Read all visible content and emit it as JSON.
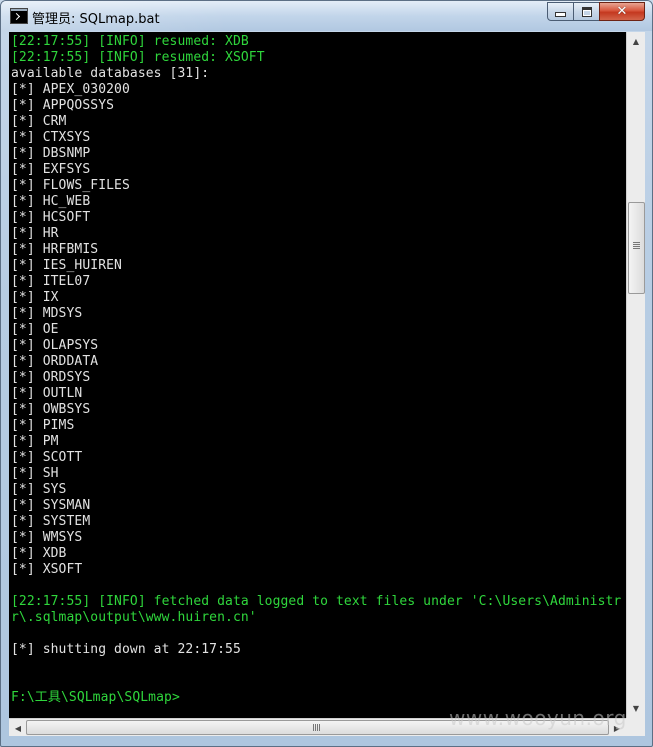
{
  "window": {
    "title": "管理员: SQLmap.bat",
    "icon": "console-window-icon"
  },
  "console": {
    "lines": [
      {
        "text": "[22:17:55] [INFO] resumed: XDB",
        "color": "#2fd63c"
      },
      {
        "text": "[22:17:55] [INFO] resumed: XSOFT",
        "color": "#2fd63c"
      },
      {
        "text": "available databases [31]:",
        "color": "#e2e2e2"
      },
      {
        "text": "[*] APEX_030200",
        "color": "#e2e2e2"
      },
      {
        "text": "[*] APPQOSSYS",
        "color": "#e2e2e2"
      },
      {
        "text": "[*] CRM",
        "color": "#e2e2e2"
      },
      {
        "text": "[*] CTXSYS",
        "color": "#e2e2e2"
      },
      {
        "text": "[*] DBSNMP",
        "color": "#e2e2e2"
      },
      {
        "text": "[*] EXFSYS",
        "color": "#e2e2e2"
      },
      {
        "text": "[*] FLOWS_FILES",
        "color": "#e2e2e2"
      },
      {
        "text": "[*] HC_WEB",
        "color": "#e2e2e2"
      },
      {
        "text": "[*] HCSOFT",
        "color": "#e2e2e2"
      },
      {
        "text": "[*] HR",
        "color": "#e2e2e2"
      },
      {
        "text": "[*] HRFBMIS",
        "color": "#e2e2e2"
      },
      {
        "text": "[*] IES_HUIREN",
        "color": "#e2e2e2"
      },
      {
        "text": "[*] ITEL07",
        "color": "#e2e2e2"
      },
      {
        "text": "[*] IX",
        "color": "#e2e2e2"
      },
      {
        "text": "[*] MDSYS",
        "color": "#e2e2e2"
      },
      {
        "text": "[*] OE",
        "color": "#e2e2e2"
      },
      {
        "text": "[*] OLAPSYS",
        "color": "#e2e2e2"
      },
      {
        "text": "[*] ORDDATA",
        "color": "#e2e2e2"
      },
      {
        "text": "[*] ORDSYS",
        "color": "#e2e2e2"
      },
      {
        "text": "[*] OUTLN",
        "color": "#e2e2e2"
      },
      {
        "text": "[*] OWBSYS",
        "color": "#e2e2e2"
      },
      {
        "text": "[*] PIMS",
        "color": "#e2e2e2"
      },
      {
        "text": "[*] PM",
        "color": "#e2e2e2"
      },
      {
        "text": "[*] SCOTT",
        "color": "#e2e2e2"
      },
      {
        "text": "[*] SH",
        "color": "#e2e2e2"
      },
      {
        "text": "[*] SYS",
        "color": "#e2e2e2"
      },
      {
        "text": "[*] SYSMAN",
        "color": "#e2e2e2"
      },
      {
        "text": "[*] SYSTEM",
        "color": "#e2e2e2"
      },
      {
        "text": "[*] WMSYS",
        "color": "#e2e2e2"
      },
      {
        "text": "[*] XDB",
        "color": "#e2e2e2"
      },
      {
        "text": "[*] XSOFT",
        "color": "#e2e2e2"
      },
      {
        "text": "",
        "color": "#e2e2e2"
      },
      {
        "text": "[22:17:55] [INFO] fetched data logged to text files under 'C:\\Users\\Administr",
        "color": "#2fd63c"
      },
      {
        "text": "r\\.sqlmap\\output\\www.huiren.cn'",
        "color": "#2fd63c"
      },
      {
        "text": "",
        "color": "#e2e2e2"
      },
      {
        "text": "[*] shutting down at 22:17:55",
        "color": "#e2e2e2"
      },
      {
        "text": "",
        "color": "#e2e2e2"
      },
      {
        "text": "",
        "color": "#e2e2e2"
      },
      {
        "text": "F:\\工具\\SQLmap\\SQLmap>",
        "color": "#2fd63c"
      }
    ]
  },
  "watermark": "www.wooyun.org",
  "controls": {
    "minimize": "minimize-icon",
    "maximize": "maximize-icon",
    "close": "close-icon"
  }
}
